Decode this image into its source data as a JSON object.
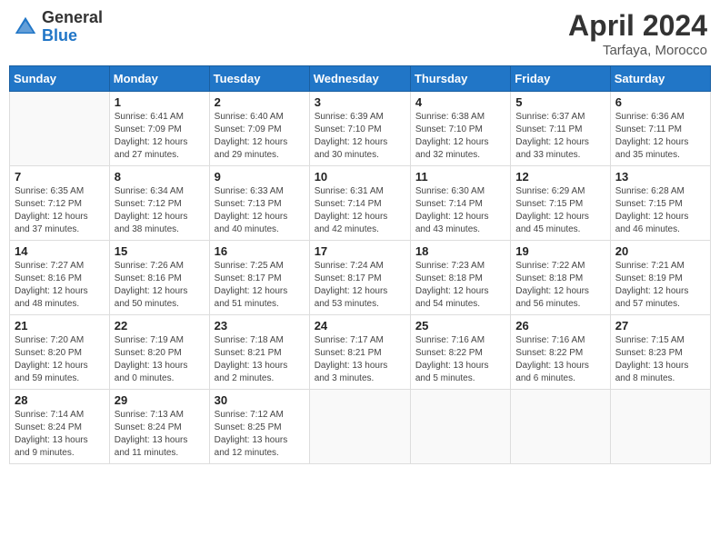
{
  "header": {
    "logo_general": "General",
    "logo_blue": "Blue",
    "month_title": "April 2024",
    "location": "Tarfaya, Morocco"
  },
  "weekdays": [
    "Sunday",
    "Monday",
    "Tuesday",
    "Wednesday",
    "Thursday",
    "Friday",
    "Saturday"
  ],
  "weeks": [
    [
      {
        "day": "",
        "info": ""
      },
      {
        "day": "1",
        "info": "Sunrise: 6:41 AM\nSunset: 7:09 PM\nDaylight: 12 hours\nand 27 minutes."
      },
      {
        "day": "2",
        "info": "Sunrise: 6:40 AM\nSunset: 7:09 PM\nDaylight: 12 hours\nand 29 minutes."
      },
      {
        "day": "3",
        "info": "Sunrise: 6:39 AM\nSunset: 7:10 PM\nDaylight: 12 hours\nand 30 minutes."
      },
      {
        "day": "4",
        "info": "Sunrise: 6:38 AM\nSunset: 7:10 PM\nDaylight: 12 hours\nand 32 minutes."
      },
      {
        "day": "5",
        "info": "Sunrise: 6:37 AM\nSunset: 7:11 PM\nDaylight: 12 hours\nand 33 minutes."
      },
      {
        "day": "6",
        "info": "Sunrise: 6:36 AM\nSunset: 7:11 PM\nDaylight: 12 hours\nand 35 minutes."
      }
    ],
    [
      {
        "day": "7",
        "info": "Sunrise: 6:35 AM\nSunset: 7:12 PM\nDaylight: 12 hours\nand 37 minutes."
      },
      {
        "day": "8",
        "info": "Sunrise: 6:34 AM\nSunset: 7:12 PM\nDaylight: 12 hours\nand 38 minutes."
      },
      {
        "day": "9",
        "info": "Sunrise: 6:33 AM\nSunset: 7:13 PM\nDaylight: 12 hours\nand 40 minutes."
      },
      {
        "day": "10",
        "info": "Sunrise: 6:31 AM\nSunset: 7:14 PM\nDaylight: 12 hours\nand 42 minutes."
      },
      {
        "day": "11",
        "info": "Sunrise: 6:30 AM\nSunset: 7:14 PM\nDaylight: 12 hours\nand 43 minutes."
      },
      {
        "day": "12",
        "info": "Sunrise: 6:29 AM\nSunset: 7:15 PM\nDaylight: 12 hours\nand 45 minutes."
      },
      {
        "day": "13",
        "info": "Sunrise: 6:28 AM\nSunset: 7:15 PM\nDaylight: 12 hours\nand 46 minutes."
      }
    ],
    [
      {
        "day": "14",
        "info": "Sunrise: 7:27 AM\nSunset: 8:16 PM\nDaylight: 12 hours\nand 48 minutes."
      },
      {
        "day": "15",
        "info": "Sunrise: 7:26 AM\nSunset: 8:16 PM\nDaylight: 12 hours\nand 50 minutes."
      },
      {
        "day": "16",
        "info": "Sunrise: 7:25 AM\nSunset: 8:17 PM\nDaylight: 12 hours\nand 51 minutes."
      },
      {
        "day": "17",
        "info": "Sunrise: 7:24 AM\nSunset: 8:17 PM\nDaylight: 12 hours\nand 53 minutes."
      },
      {
        "day": "18",
        "info": "Sunrise: 7:23 AM\nSunset: 8:18 PM\nDaylight: 12 hours\nand 54 minutes."
      },
      {
        "day": "19",
        "info": "Sunrise: 7:22 AM\nSunset: 8:18 PM\nDaylight: 12 hours\nand 56 minutes."
      },
      {
        "day": "20",
        "info": "Sunrise: 7:21 AM\nSunset: 8:19 PM\nDaylight: 12 hours\nand 57 minutes."
      }
    ],
    [
      {
        "day": "21",
        "info": "Sunrise: 7:20 AM\nSunset: 8:20 PM\nDaylight: 12 hours\nand 59 minutes."
      },
      {
        "day": "22",
        "info": "Sunrise: 7:19 AM\nSunset: 8:20 PM\nDaylight: 13 hours\nand 0 minutes."
      },
      {
        "day": "23",
        "info": "Sunrise: 7:18 AM\nSunset: 8:21 PM\nDaylight: 13 hours\nand 2 minutes."
      },
      {
        "day": "24",
        "info": "Sunrise: 7:17 AM\nSunset: 8:21 PM\nDaylight: 13 hours\nand 3 minutes."
      },
      {
        "day": "25",
        "info": "Sunrise: 7:16 AM\nSunset: 8:22 PM\nDaylight: 13 hours\nand 5 minutes."
      },
      {
        "day": "26",
        "info": "Sunrise: 7:16 AM\nSunset: 8:22 PM\nDaylight: 13 hours\nand 6 minutes."
      },
      {
        "day": "27",
        "info": "Sunrise: 7:15 AM\nSunset: 8:23 PM\nDaylight: 13 hours\nand 8 minutes."
      }
    ],
    [
      {
        "day": "28",
        "info": "Sunrise: 7:14 AM\nSunset: 8:24 PM\nDaylight: 13 hours\nand 9 minutes."
      },
      {
        "day": "29",
        "info": "Sunrise: 7:13 AM\nSunset: 8:24 PM\nDaylight: 13 hours\nand 11 minutes."
      },
      {
        "day": "30",
        "info": "Sunrise: 7:12 AM\nSunset: 8:25 PM\nDaylight: 13 hours\nand 12 minutes."
      },
      {
        "day": "",
        "info": ""
      },
      {
        "day": "",
        "info": ""
      },
      {
        "day": "",
        "info": ""
      },
      {
        "day": "",
        "info": ""
      }
    ]
  ]
}
